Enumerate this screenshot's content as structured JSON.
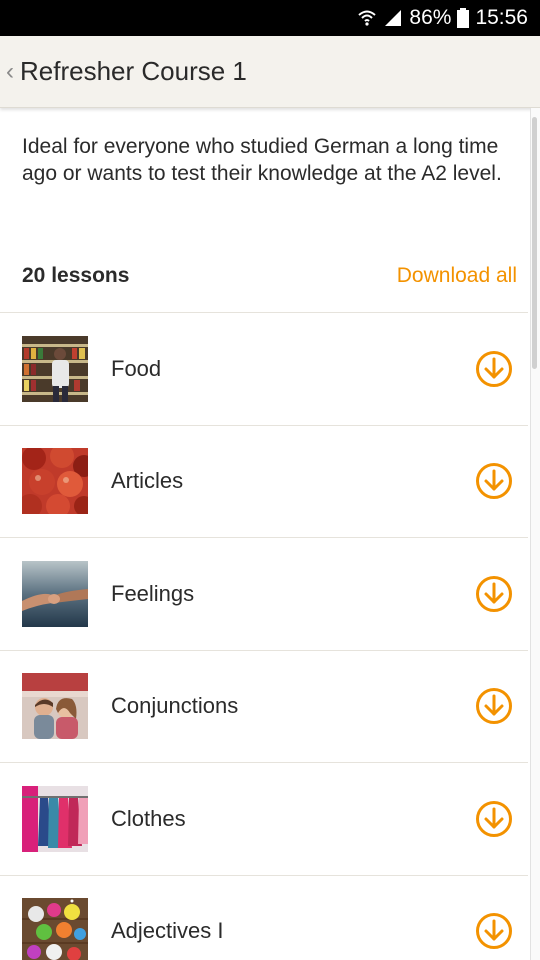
{
  "status": {
    "battery": "86%",
    "time": "15:56",
    "icons": [
      "wifi-icon",
      "signal-icon",
      "battery-icon"
    ]
  },
  "header": {
    "title": "Refresher Course 1",
    "back_icon": "chevron-left-icon"
  },
  "course": {
    "description": "Ideal for everyone who studied German a long time ago or wants to test their knowledge at the A2 level.",
    "lessons_count": "20 lessons",
    "download_all": "Download all"
  },
  "lessons": [
    {
      "title": "Food"
    },
    {
      "title": "Articles"
    },
    {
      "title": "Feelings"
    },
    {
      "title": "Conjunctions"
    },
    {
      "title": "Clothes"
    },
    {
      "title": "Adjectives I"
    }
  ],
  "colors": {
    "accent": "#f39200",
    "app_bar": "#f4f2ed",
    "text": "#2b2b2b"
  }
}
